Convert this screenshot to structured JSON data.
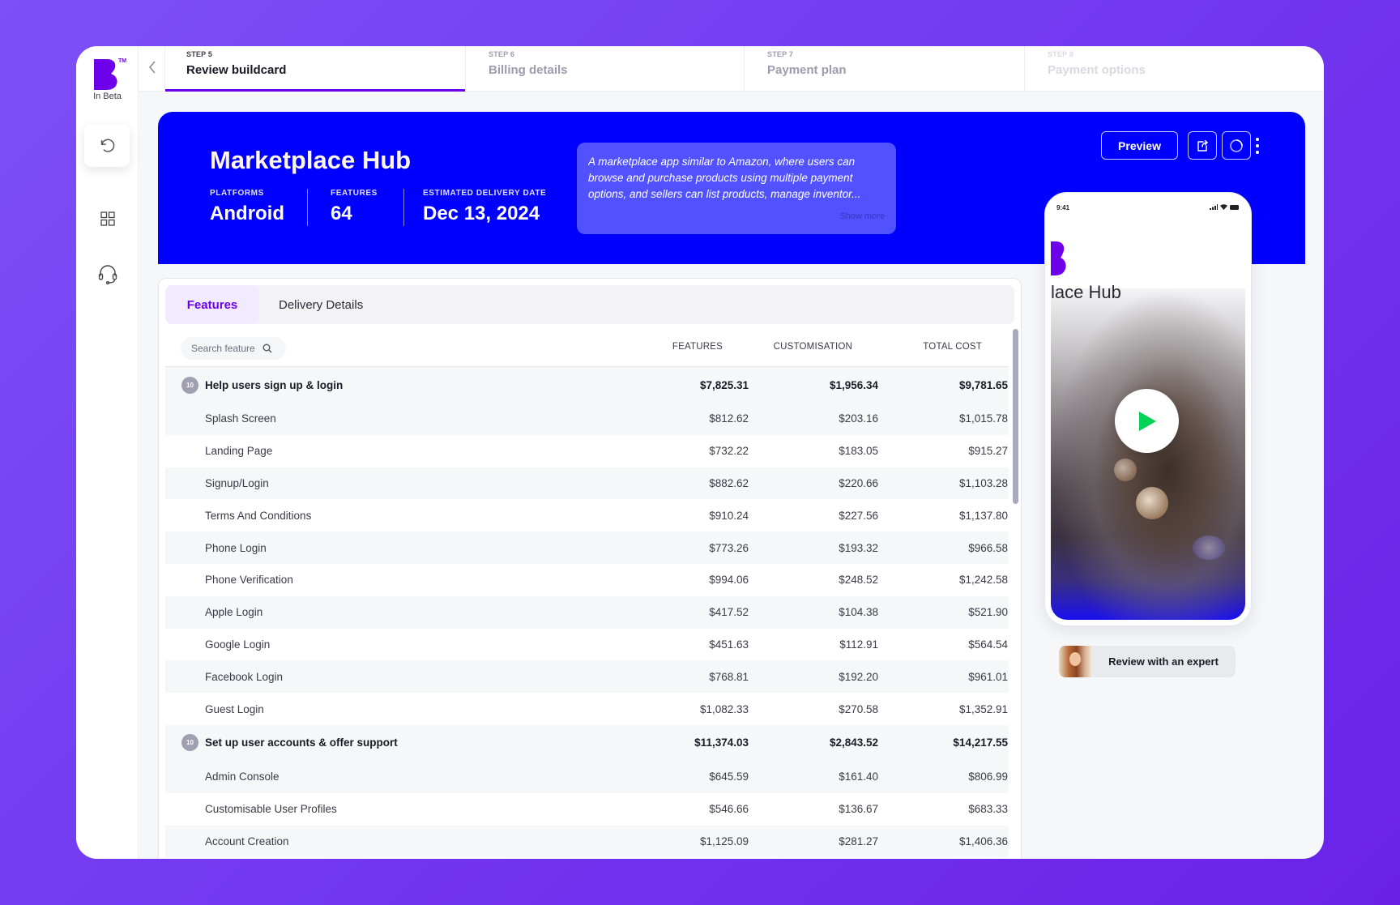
{
  "brand": {
    "badge": "In Beta",
    "trademark": "TM",
    "logo_color": "#6c00ea"
  },
  "sidebar": {
    "items": [
      {
        "name": "undo",
        "icon": "undo-icon"
      },
      {
        "name": "dashboard",
        "icon": "grid-icon"
      },
      {
        "name": "support",
        "icon": "headset-icon"
      }
    ]
  },
  "steps": [
    {
      "label": "STEP 5",
      "title": "Review buildcard",
      "state": "active"
    },
    {
      "label": "STEP 6",
      "title": "Billing details",
      "state": "upcoming"
    },
    {
      "label": "STEP 7",
      "title": "Payment plan",
      "state": "upcoming"
    },
    {
      "label": "STEP 8",
      "title": "Payment options",
      "state": "disabled"
    }
  ],
  "hero": {
    "title": "Marketplace Hub",
    "meta": [
      {
        "key": "PLATFORMS",
        "value": "Android"
      },
      {
        "key": "FEATURES",
        "value": "64"
      },
      {
        "key": "ESTIMATED DELIVERY DATE",
        "value": "Dec 13, 2024"
      }
    ],
    "description": "A marketplace app similar to Amazon, where users can browse and purchase products using multiple payment options, and sellers can list products, manage inventor...",
    "show_more": "Show more",
    "preview_label": "Preview",
    "accent": "#0000ff"
  },
  "phone": {
    "time": "9:41",
    "app_name": "lace Hub"
  },
  "expert": {
    "label": "Review with an expert"
  },
  "table": {
    "tabs": [
      {
        "label": "Features",
        "active": true
      },
      {
        "label": "Delivery Details",
        "active": false
      }
    ],
    "search_placeholder": "Search feature",
    "columns": [
      "FEATURES",
      "CUSTOMISATION",
      "TOTAL COST"
    ],
    "rows": [
      {
        "type": "group",
        "count": "10",
        "name": "Help users sign up & login",
        "features": "$7,825.31",
        "customisation": "$1,956.34",
        "total": "$9,781.65"
      },
      {
        "type": "item",
        "name": "Splash Screen",
        "features": "$812.62",
        "customisation": "$203.16",
        "total": "$1,015.78"
      },
      {
        "type": "item",
        "name": "Landing Page",
        "features": "$732.22",
        "customisation": "$183.05",
        "total": "$915.27"
      },
      {
        "type": "item",
        "name": "Signup/Login",
        "features": "$882.62",
        "customisation": "$220.66",
        "total": "$1,103.28"
      },
      {
        "type": "item",
        "name": "Terms And Conditions",
        "features": "$910.24",
        "customisation": "$227.56",
        "total": "$1,137.80"
      },
      {
        "type": "item",
        "name": "Phone Login",
        "features": "$773.26",
        "customisation": "$193.32",
        "total": "$966.58"
      },
      {
        "type": "item",
        "name": "Phone Verification",
        "features": "$994.06",
        "customisation": "$248.52",
        "total": "$1,242.58"
      },
      {
        "type": "item",
        "name": "Apple Login",
        "features": "$417.52",
        "customisation": "$104.38",
        "total": "$521.90"
      },
      {
        "type": "item",
        "name": "Google Login",
        "features": "$451.63",
        "customisation": "$112.91",
        "total": "$564.54"
      },
      {
        "type": "item",
        "name": "Facebook Login",
        "features": "$768.81",
        "customisation": "$192.20",
        "total": "$961.01"
      },
      {
        "type": "item",
        "name": "Guest Login",
        "features": "$1,082.33",
        "customisation": "$270.58",
        "total": "$1,352.91"
      },
      {
        "type": "group",
        "count": "10",
        "name": "Set up user accounts & offer support",
        "features": "$11,374.03",
        "customisation": "$2,843.52",
        "total": "$14,217.55"
      },
      {
        "type": "item",
        "name": "Admin Console",
        "features": "$645.59",
        "customisation": "$161.40",
        "total": "$806.99"
      },
      {
        "type": "item",
        "name": "Customisable User Profiles",
        "features": "$546.66",
        "customisation": "$136.67",
        "total": "$683.33"
      },
      {
        "type": "item",
        "name": "Account Creation",
        "features": "$1,125.09",
        "customisation": "$281.27",
        "total": "$1,406.36"
      }
    ]
  }
}
